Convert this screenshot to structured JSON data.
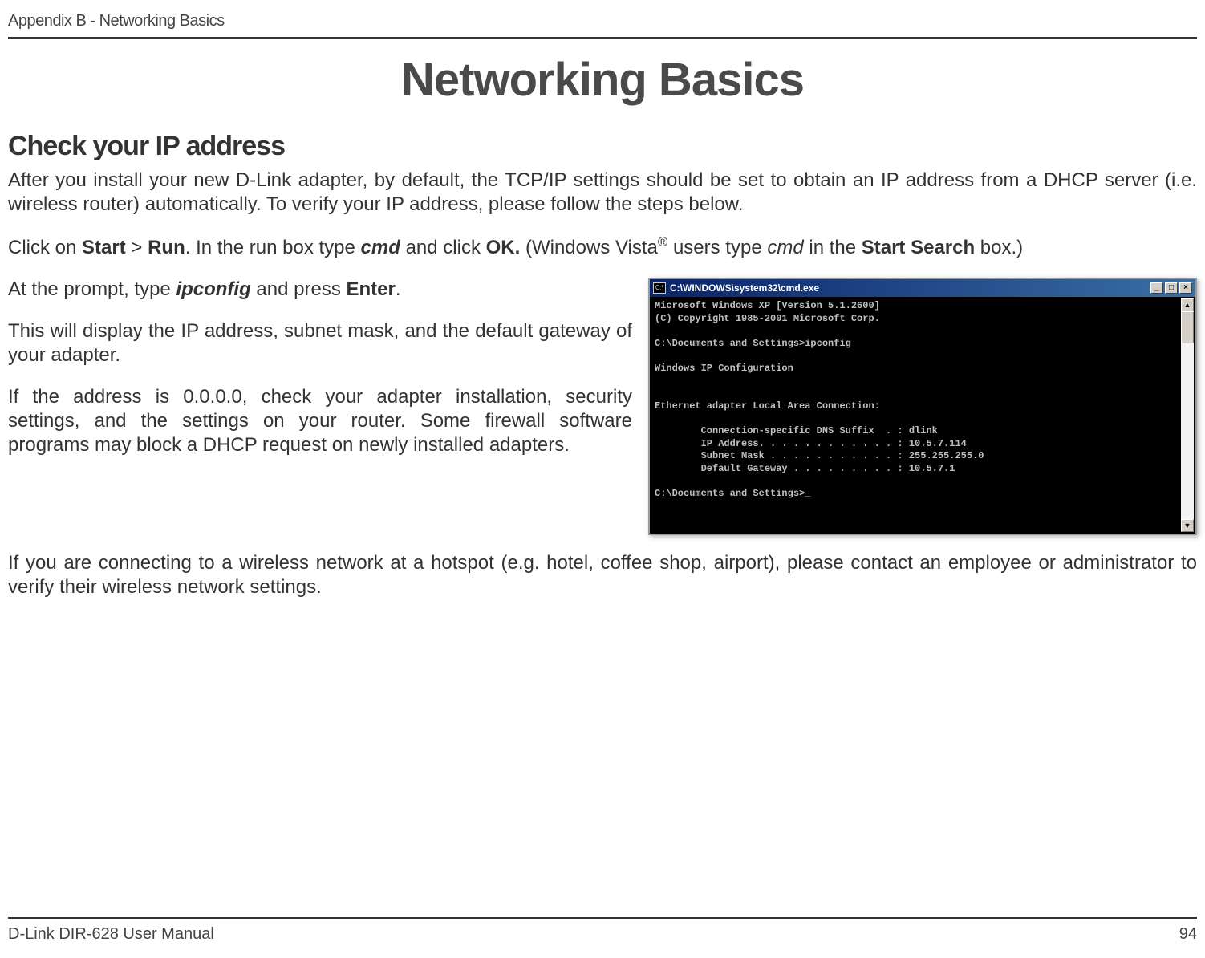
{
  "header": {
    "appendix": "Appendix B - Networking Basics"
  },
  "title": "Networking Basics",
  "section_heading": "Check your IP address",
  "paragraphs": {
    "intro": "After you install your new D-Link adapter, by default, the TCP/IP settings should be set to obtain an IP address from a DHCP server (i.e. wireless router) automatically. To verify your IP address, please follow the steps below.",
    "click_start_pre": "Click on ",
    "start": "Start",
    "gt": " > ",
    "run": "Run",
    "click_mid1": ". In the run box type ",
    "cmd": "cmd",
    "click_mid2": " and click ",
    "ok": "OK.",
    "click_mid3": " (Windows Vista",
    "reg": "®",
    "click_mid4": " users type ",
    "cmd_italic": "cmd",
    "click_mid5": " in the ",
    "start_search": "Start Search",
    "click_end": " box.)",
    "prompt_pre": "At the prompt, type ",
    "ipconfig": "ipconfig",
    "prompt_mid": " and press ",
    "enter": "Enter",
    "prompt_end": ".",
    "display": "This will display the IP address, subnet mask, and the default gateway of your adapter.",
    "zero_address": "If the address is 0.0.0.0, check your adapter installation, security settings, and the settings on your router. Some firewall software programs may block a DHCP request on newly installed adapters.",
    "hotspot": "If you are connecting to a wireless network at a hotspot (e.g. hotel, coffee shop, airport), please contact an employee or administrator to verify their wireless network settings."
  },
  "cmd_window": {
    "title": "C:\\WINDOWS\\system32\\cmd.exe",
    "icon_text": "C:\\",
    "minimize": "_",
    "maximize": "□",
    "close": "×",
    "content": "Microsoft Windows XP [Version 5.1.2600]\n(C) Copyright 1985-2001 Microsoft Corp.\n\nC:\\Documents and Settings>ipconfig\n\nWindows IP Configuration\n\n\nEthernet adapter Local Area Connection:\n\n        Connection-specific DNS Suffix  . : dlink\n        IP Address. . . . . . . . . . . . : 10.5.7.114\n        Subnet Mask . . . . . . . . . . . : 255.255.255.0\n        Default Gateway . . . . . . . . . : 10.5.7.1\n\nC:\\Documents and Settings>_",
    "scroll_up": "▲",
    "scroll_down": "▼"
  },
  "footer": {
    "manual": "D-Link DIR-628 User Manual",
    "page": "94"
  }
}
